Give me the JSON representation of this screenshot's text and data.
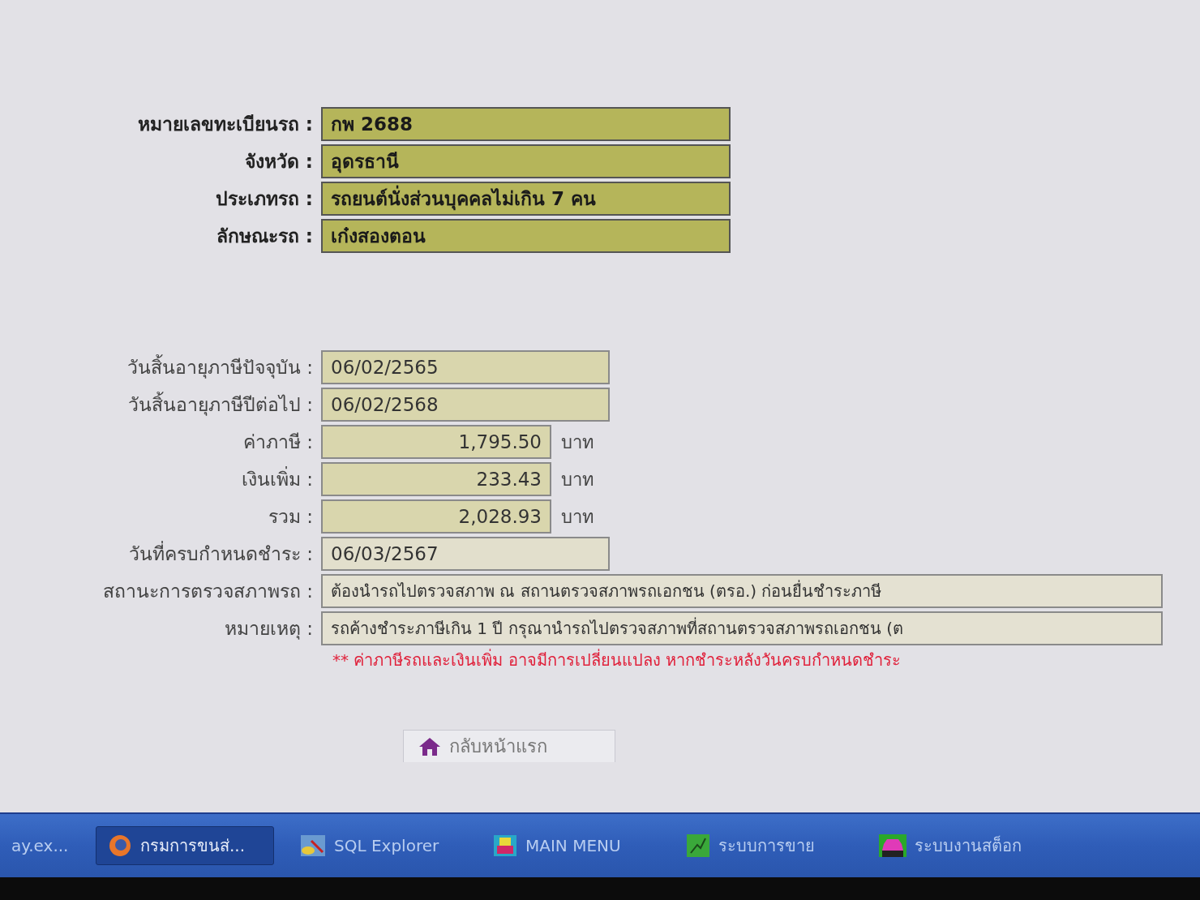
{
  "vehicle": [
    {
      "label": "หมายเลขทะเบียนรถ :",
      "value": "กพ 2688"
    },
    {
      "label": "จังหวัด :",
      "value": "อุดรธานี"
    },
    {
      "label": "ประเภทรถ :",
      "value": "รถยนต์นั่งส่วนบุคคลไม่เกิน 7 คน"
    },
    {
      "label": "ลักษณะรถ :",
      "value": "เก๋งสองตอน"
    }
  ],
  "tax": [
    {
      "kind": "date",
      "label": "วันสิ้นอายุภาษีปัจจุบัน :",
      "value": "06/02/2565"
    },
    {
      "kind": "date",
      "label": "วันสิ้นอายุภาษีปีต่อไป :",
      "value": "06/02/2568"
    },
    {
      "kind": "amount",
      "label": "ค่าภาษี :",
      "value": "1,795.50",
      "unit": "บาท"
    },
    {
      "kind": "amount",
      "label": "เงินเพิ่ม :",
      "value": "233.43",
      "unit": "บาท"
    },
    {
      "kind": "amount",
      "label": "รวม :",
      "value": "2,028.93",
      "unit": "บาท"
    },
    {
      "kind": "plain",
      "label": "วันที่ครบกำหนดชำระ :",
      "value": "06/03/2567"
    },
    {
      "kind": "wide",
      "label": "สถานะการตรวจสภาพรถ :",
      "value": "ต้องนำรถไปตรวจสภาพ ณ สถานตรวจสภาพรถเอกชน (ตรอ.) ก่อนยื่นชำระภาษี"
    },
    {
      "kind": "wide",
      "label": "หมายเหตุ :",
      "value": "รถค้างชำระภาษีเกิน 1 ปี กรุณานำรถไปตรวจสภาพที่สถานตรวจสภาพรถเอกชน (ต"
    }
  ],
  "warning": "** ค่าภาษีรถและเงินเพิ่ม อาจมีการเปลี่ยนแปลง หากชำระหลังวันครบกำหนดชำระ",
  "home_button": "กลับหน้าแรก",
  "taskbar": [
    {
      "kind": "text",
      "label": "ay.ex...",
      "selected": false
    },
    {
      "kind": "browser",
      "label": "กรมการขนส่...",
      "selected": true
    },
    {
      "kind": "database",
      "label": "SQL Explorer",
      "selected": false
    },
    {
      "kind": "menu",
      "label": "MAIN MENU",
      "selected": false
    },
    {
      "kind": "sales",
      "label": "ระบบการขาย",
      "selected": false
    },
    {
      "kind": "car",
      "label": "ระบบงานสต็อก",
      "selected": false
    }
  ]
}
